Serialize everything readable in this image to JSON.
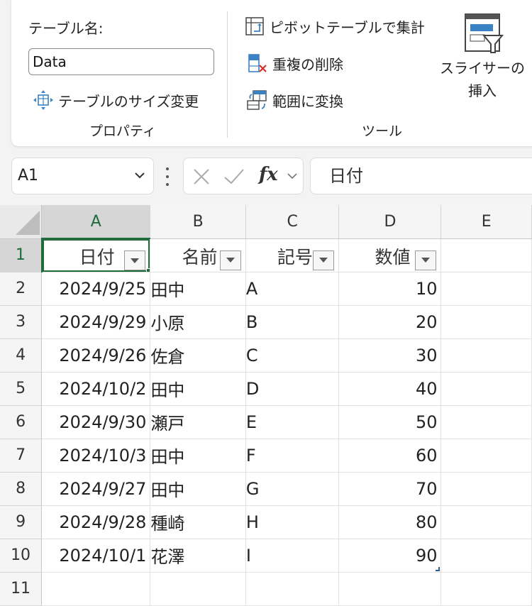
{
  "ribbon": {
    "properties": {
      "table_name_label": "テーブル名:",
      "table_name_value": "Data",
      "resize_label": "テーブルのサイズ変更",
      "caption": "プロパティ"
    },
    "tools": {
      "pivot_label": "ピボットテーブルで集計",
      "remove_duplicates_label": "重複の削除",
      "convert_range_label": "範囲に変換",
      "slicer_label_1": "スライサーの",
      "slicer_label_2": "挿入",
      "caption": "ツール"
    }
  },
  "formula_bar": {
    "name_box": "A1",
    "fx_symbol": "fx",
    "formula": "日付"
  },
  "sheet": {
    "column_headers": [
      "A",
      "B",
      "C",
      "D",
      "E"
    ],
    "row_headers": [
      "1",
      "2",
      "3",
      "4",
      "5",
      "6",
      "7",
      "8",
      "9",
      "10",
      "11"
    ],
    "header_row": [
      "日付",
      "名前",
      "記号",
      "数値"
    ],
    "rows": [
      [
        "2024/9/25",
        "田中",
        "A",
        "10"
      ],
      [
        "2024/9/29",
        "小原",
        "B",
        "20"
      ],
      [
        "2024/9/26",
        "佐倉",
        "C",
        "30"
      ],
      [
        "2024/10/2",
        "田中",
        "D",
        "40"
      ],
      [
        "2024/9/30",
        "瀬戸",
        "E",
        "50"
      ],
      [
        "2024/10/3",
        "田中",
        "F",
        "60"
      ],
      [
        "2024/9/27",
        "田中",
        "G",
        "70"
      ],
      [
        "2024/9/28",
        "種崎",
        "H",
        "80"
      ],
      [
        "2024/10/1",
        "花澤",
        "I",
        "90"
      ]
    ],
    "active_cell": "A1"
  },
  "colors": {
    "accent_green": "#1e6b3c",
    "icon_blue": "#3b82c4",
    "icon_red": "#d93025"
  }
}
